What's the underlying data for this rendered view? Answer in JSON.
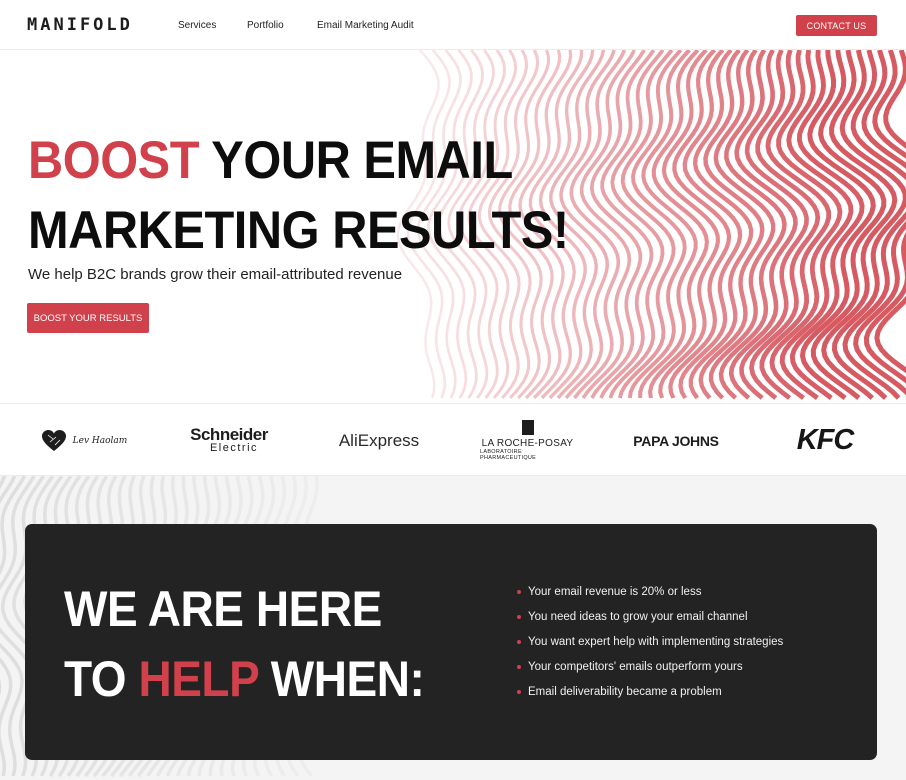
{
  "brand": {
    "logo": "MANIFOLD",
    "accent_color": "#d0414b",
    "dark_color": "#232323"
  },
  "nav": {
    "links": [
      "Services",
      "Portfolio",
      "Email Marketing Audit"
    ],
    "cta": "CONTACT US"
  },
  "hero": {
    "title_accent": "BOOST",
    "title_line1_rest": " YOUR EMAIL",
    "title_line2": "MARKETING RESULTS!",
    "subtitle": "We help B2C brands grow their email-attributed revenue",
    "cta": "BOOST YOUR RESULTS"
  },
  "clients": {
    "lev_haolam": "Lev Haolam",
    "schneider_line1": "Schneider",
    "schneider_line2": "Electric",
    "aliexpress": "AliExpress",
    "laroche_line1": "LA ROCHE-POSAY",
    "laroche_line2": "LABORATOIRE PHARMACEUTIQUE",
    "papajohns": "PAPA JOHNS",
    "kfc": "KFC"
  },
  "help": {
    "title_line1": "WE ARE HERE",
    "title_line2_pre": "TO ",
    "title_line2_accent": "HELP",
    "title_line2_post": " WHEN:",
    "bullets": [
      "Your email revenue is 20% or less",
      "You need ideas to grow your email channel",
      "You want expert help with implementing strategies",
      "Your competitors' emails outperform yours",
      "Email deliverability became a problem"
    ]
  }
}
